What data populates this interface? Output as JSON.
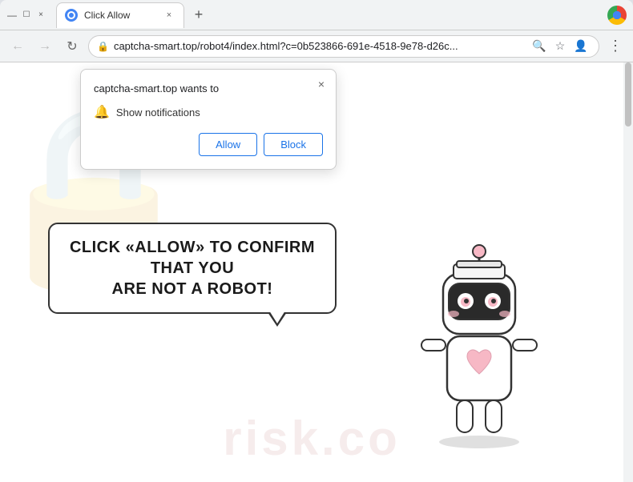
{
  "window": {
    "title": "Click Allow",
    "tab_label": "Click Allow",
    "close_btn": "×",
    "new_tab_btn": "+",
    "minimize_btn": "—",
    "maximize_btn": "☐",
    "close_window_btn": "×"
  },
  "addressbar": {
    "back_arrow": "←",
    "forward_arrow": "→",
    "reload": "↻",
    "url": "captcha-smart.top/robot4/index.html?c=0b523866-691e-4518-9e78-d26c...",
    "search_icon": "🔍",
    "bookmark_icon": "☆",
    "profile_icon": "👤",
    "menu_icon": "⋮",
    "lock_icon": "🔒"
  },
  "notification_popup": {
    "title": "captcha-smart.top wants to",
    "notification_text": "Show notifications",
    "allow_btn": "Allow",
    "block_btn": "Block",
    "close_btn": "×"
  },
  "speech_bubble": {
    "line1": "CLICK «ALLOW» TO CONFIRM THAT YOU",
    "line2": "ARE NOT A ROBOT!"
  },
  "watermark": {
    "text": "risk.co"
  }
}
